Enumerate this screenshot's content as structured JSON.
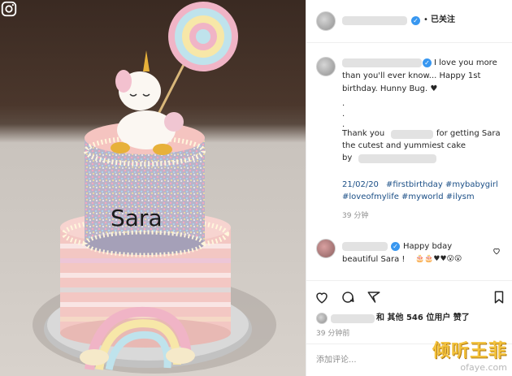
{
  "header": {
    "follow_label": "已关注",
    "dot": "•"
  },
  "caption": {
    "lines": [
      "I love you more",
      "than you'll ever know... Happy 1st",
      "birthday. Hunny Bug. ♥",
      ".",
      ".",
      ".",
      "Thank you",
      "for getting Sara",
      "the cutest and yummiest cake",
      "by",
      "21/02/20",
      "#firstbirthday #mybabygirl",
      "#loveofmylife #myworld #ilysm"
    ],
    "time": "39 分钟"
  },
  "comment": {
    "text_1": "Happy bday",
    "text_2": "beautiful Sara !",
    "emojis": "🎂🎂♥♥😮😮"
  },
  "likes": {
    "text": "和 其他 546 位用户 赞了"
  },
  "post_time": "39 分钟前",
  "add_comment_placeholder": "添加评论...",
  "photo": {
    "cake_name": "Sara"
  },
  "watermark": {
    "main": "倾听王菲",
    "sub": "ofaye.com"
  },
  "icons": {
    "like": "heart-icon",
    "comment": "comment-icon",
    "share": "share-icon",
    "save": "bookmark-icon",
    "verified": "verified-badge-icon",
    "instagram": "instagram-icon"
  },
  "colors": {
    "link": "#1a4e86",
    "verified": "#3897f0"
  }
}
